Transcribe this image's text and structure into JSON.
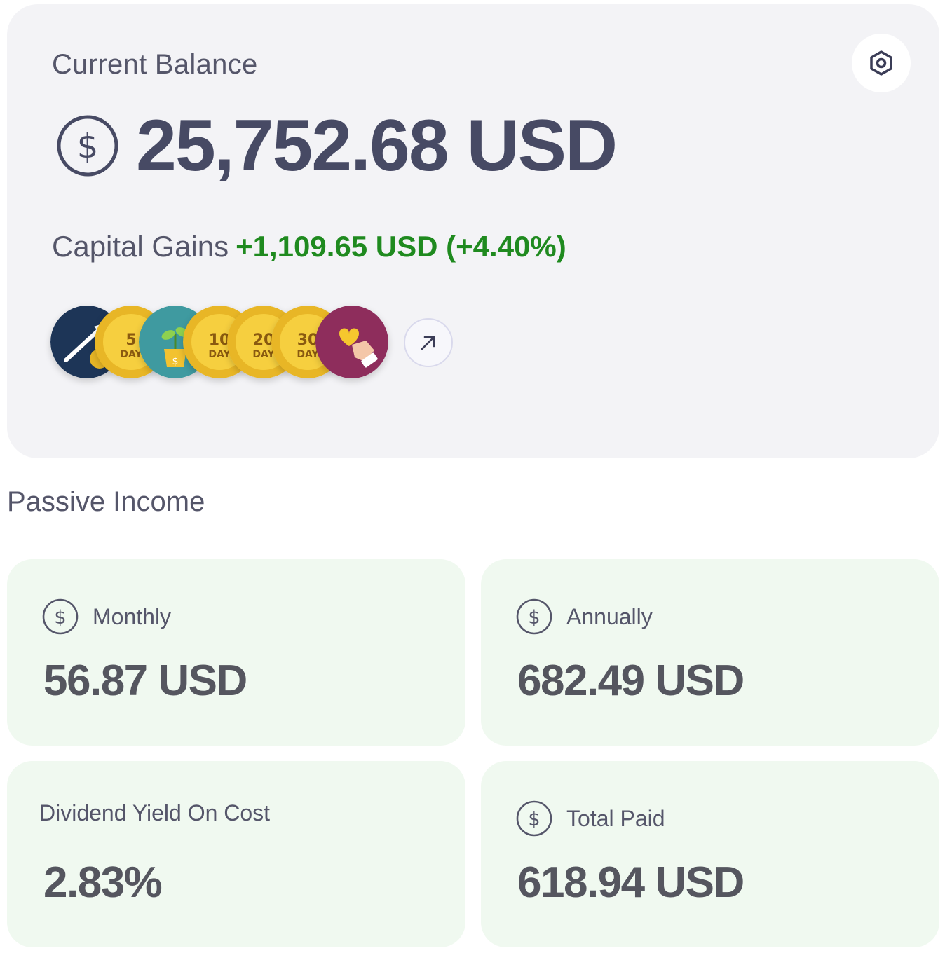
{
  "balance": {
    "label": "Current Balance",
    "amount": "25,752.68 USD",
    "gains_label": "Capital Gains",
    "gains_value": "+1,109.65 USD (+4.40%)"
  },
  "badges": [
    {
      "name": "growth-arrow-badge",
      "text": ""
    },
    {
      "name": "5-day-badge",
      "number": "5",
      "unit": "DAY"
    },
    {
      "name": "plant-badge",
      "text": ""
    },
    {
      "name": "10-day-badge",
      "number": "10",
      "unit": "DAY"
    },
    {
      "name": "20-day-badge",
      "number": "20",
      "unit": "DAY"
    },
    {
      "name": "30-day-badge",
      "number": "30",
      "unit": "DAY"
    },
    {
      "name": "heart-hand-badge",
      "text": ""
    }
  ],
  "passive_income": {
    "title": "Passive Income",
    "monthly": {
      "label": "Monthly",
      "value": "56.87 USD"
    },
    "annually": {
      "label": "Annually",
      "value": "682.49 USD"
    },
    "yield": {
      "label": "Dividend Yield On Cost",
      "value": "2.83%"
    },
    "total_paid": {
      "label": "Total Paid",
      "value": "618.94 USD"
    }
  },
  "colors": {
    "card_bg": "#f3f3f6",
    "stat_bg": "#f0f9f0",
    "gain_green": "#1f8a1f",
    "text_dark": "#474a64",
    "badge_gold": "#f2c230",
    "badge_navy": "#1d3557",
    "badge_teal": "#3f9aa0",
    "badge_plum": "#8e2d5c"
  },
  "icons": [
    "dollar-circle-icon",
    "settings-hex-icon",
    "arrow-up-right-icon"
  ]
}
